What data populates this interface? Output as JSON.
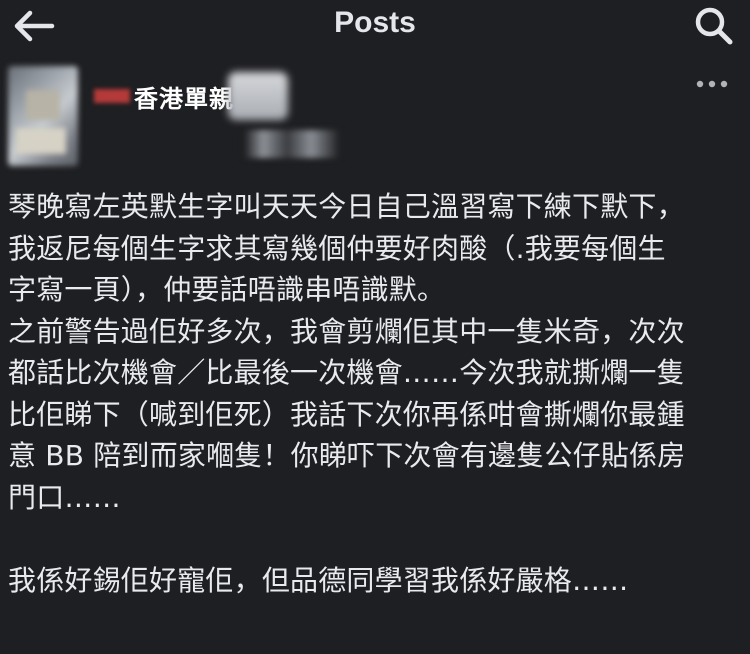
{
  "header": {
    "title": "Posts",
    "back_icon": "arrow-left-icon",
    "search_icon": "search-icon"
  },
  "post": {
    "author_name": "香港單親",
    "more_icon": "more-horizontal-icon",
    "body": "琴晚寫左英默生字叫天天今日自己溫習寫下練下默下，\n我返尼每個生字求其寫幾個仲要好肉酸（.我要每個生\n字寫一頁），仲要話唔識串唔識默。\n之前警告過佢好多次，我會剪爛佢其中一隻米奇，次次\n都話比次機會／比最後一次機會……今次我就撕爛一隻\n比佢睇下（喊到佢死）我話下次你再係咁會撕爛你最鍾\n意 BB 陪到而家嗰隻！你睇吓下次會有邊隻公仔貼係房\n門口……\n\n我係好錫佢好寵佢，但品德同學習我係好嚴格……"
  }
}
